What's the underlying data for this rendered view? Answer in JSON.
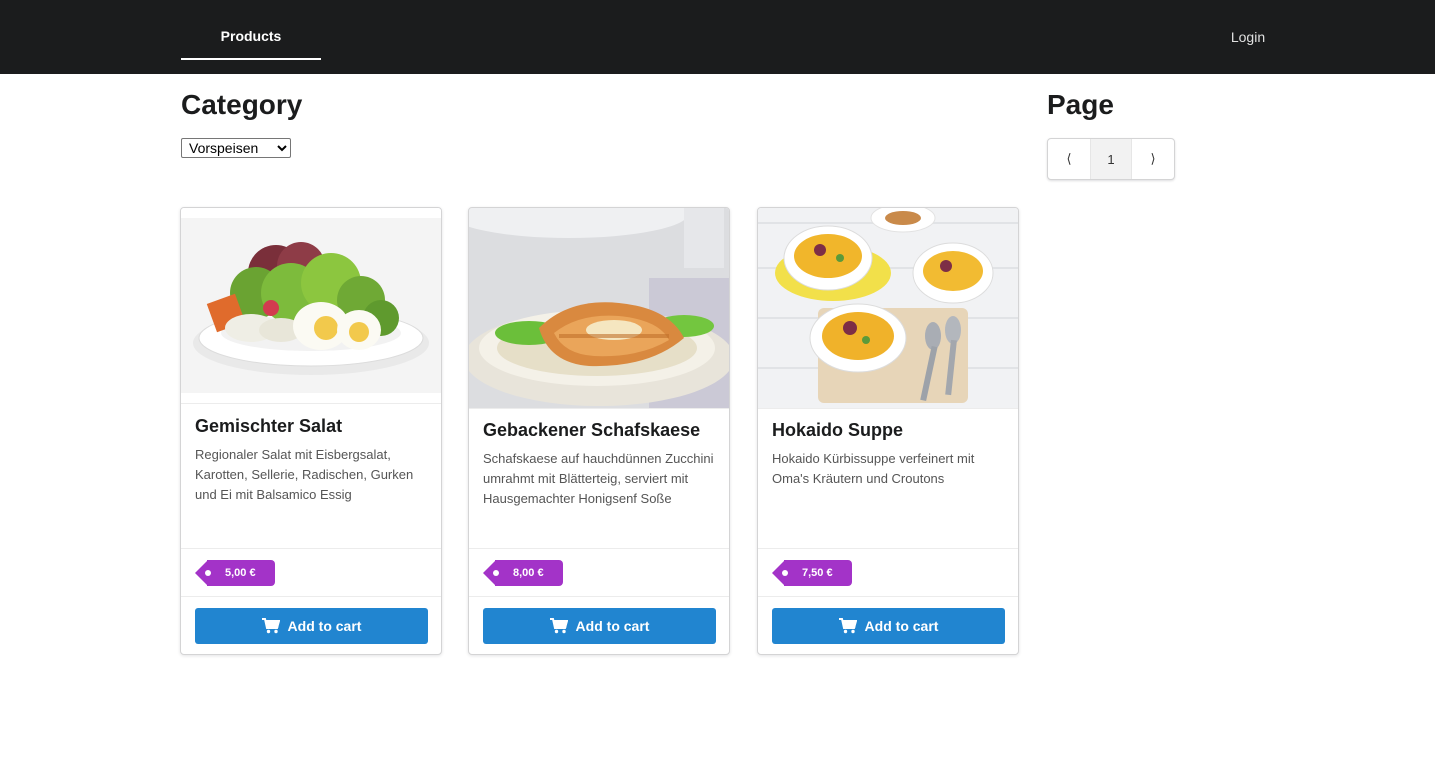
{
  "nav": {
    "products_label": "Products",
    "login_label": "Login"
  },
  "category": {
    "heading": "Category",
    "selected": "Vorspeisen"
  },
  "pagination": {
    "heading": "Page",
    "prev": "⟨",
    "current": "1",
    "next": "⟩"
  },
  "products": [
    {
      "title": "Gemischter Salat",
      "description": "Regionaler Salat mit Eisbergsalat, Karotten, Sellerie, Radischen, Gurken und Ei mit Balsamico Essig",
      "price": "5,00 €",
      "cart_label": "Add to cart"
    },
    {
      "title": "Gebackener Schafskaese",
      "description": "Schafskaese auf hauchdünnen Zucchini umrahmt mit Blätterteig, serviert mit Hausgemachter Honigsenf Soße",
      "price": "8,00 €",
      "cart_label": "Add to cart"
    },
    {
      "title": "Hokaido Suppe",
      "description": "Hokaido Kürbissuppe verfeinert mit Oma's Kräutern und Croutons",
      "price": "7,50 €",
      "cart_label": "Add to cart"
    }
  ],
  "colors": {
    "nav_bg": "#1b1c1d",
    "price_tag": "#a333c8",
    "cart_button": "#2185d0"
  },
  "icons": [
    "cart-icon",
    "chevron-left-icon",
    "chevron-right-icon",
    "dropdown-icon"
  ]
}
